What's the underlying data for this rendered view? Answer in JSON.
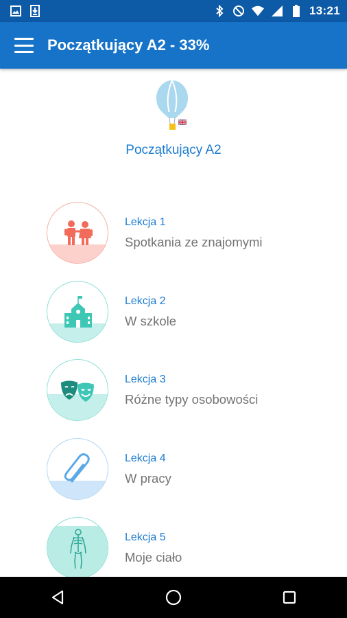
{
  "status_bar": {
    "time": "13:21",
    "icons": [
      "image-icon",
      "download-icon",
      "bluetooth-icon",
      "do-not-disturb-icon",
      "wifi-icon",
      "signal-icon",
      "battery-icon"
    ]
  },
  "app_bar": {
    "title": "Początkujący A2 - 33%",
    "menu_icon": "menu-icon",
    "color": "#1673c8"
  },
  "course": {
    "name": "Początkujący A2",
    "icon": "hot-air-balloon-icon",
    "flag": "uk-flag-icon"
  },
  "lessons": [
    {
      "number": "Lekcja 1",
      "title": "Spotkania ze znajomymi",
      "icon": "children-icon",
      "color": "#f26b5b"
    },
    {
      "number": "Lekcja 2",
      "title": "W szkole",
      "icon": "school-building-icon",
      "color": "#3fc7b6"
    },
    {
      "number": "Lekcja 3",
      "title": "Różne typy osobowości",
      "icon": "theater-masks-icon",
      "color": "#3fc7b6"
    },
    {
      "number": "Lekcja 4",
      "title": "W pracy",
      "icon": "paperclip-icon",
      "color": "#5aa9e6"
    },
    {
      "number": "Lekcja 5",
      "title": "Moje ciało",
      "icon": "skeleton-icon",
      "color": "#3fc7b6"
    }
  ],
  "nav_bar": {
    "back_icon": "back-icon",
    "home_icon": "home-icon",
    "recents_icon": "recents-icon"
  }
}
